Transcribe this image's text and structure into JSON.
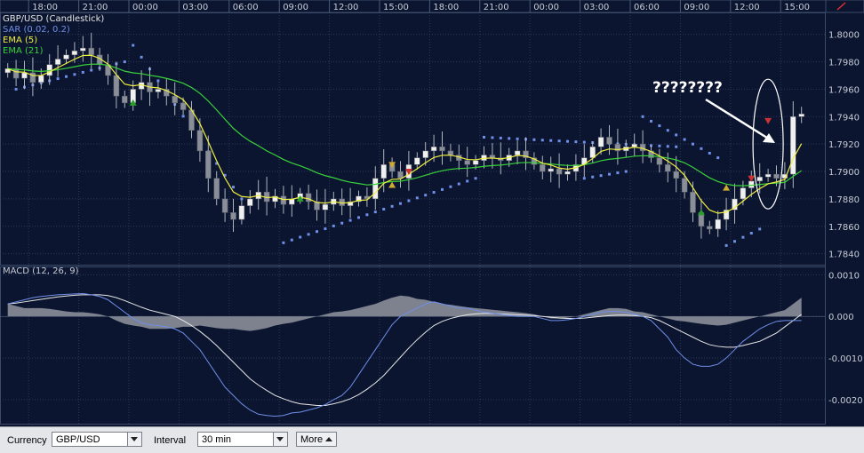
{
  "chart_data": [
    {
      "type": "candlestick",
      "title": "GBP/USD (Candlestick)",
      "legend": [
        "SAR (0.02, 0.2)",
        "EMA (5)",
        "EMA (21)"
      ],
      "legend_colors": [
        "#6f8fe8",
        "#f0f040",
        "#3ad23a"
      ],
      "x_ticks": [
        "18:00",
        "21:00",
        "00:00",
        "03:00",
        "06:00",
        "09:00",
        "12:00",
        "15:00",
        "18:00",
        "21:00",
        "00:00",
        "03:00",
        "06:00",
        "09:00",
        "12:00",
        "15:00",
        "18:00"
      ],
      "y_ticks": [
        "1.8000",
        "1.7980",
        "1.7960",
        "1.7940",
        "1.7920",
        "1.7900",
        "1.7880",
        "1.7860",
        "1.7840"
      ],
      "ylim": [
        1.7832,
        1.8016
      ],
      "n_bars": 96,
      "closes": [
        1.7975,
        1.7968,
        1.7972,
        1.7965,
        1.797,
        1.7978,
        1.7982,
        1.7985,
        1.7988,
        1.799,
        1.7985,
        1.7978,
        1.797,
        1.7955,
        1.795,
        1.796,
        1.7965,
        1.7958,
        1.796,
        1.7955,
        1.795,
        1.7945,
        1.793,
        1.7915,
        1.7895,
        1.788,
        1.787,
        1.7865,
        1.7875,
        1.788,
        1.7885,
        1.7878,
        1.7882,
        1.7876,
        1.788,
        1.7884,
        1.7878,
        1.7872,
        1.7876,
        1.788,
        1.7875,
        1.7878,
        1.7882,
        1.788,
        1.7895,
        1.7905,
        1.79,
        1.7895,
        1.7905,
        1.791,
        1.7915,
        1.7918,
        1.7915,
        1.7912,
        1.7908,
        1.7905,
        1.7908,
        1.7912,
        1.791,
        1.7908,
        1.7912,
        1.7915,
        1.791,
        1.7905,
        1.79,
        1.7902,
        1.7898,
        1.79,
        1.7905,
        1.791,
        1.7918,
        1.7925,
        1.792,
        1.7915,
        1.7918,
        1.792,
        1.7915,
        1.791,
        1.7905,
        1.79,
        1.7895,
        1.7885,
        1.787,
        1.786,
        1.7858,
        1.7865,
        1.7872,
        1.788,
        1.7888,
        1.7893,
        1.7896,
        1.7898,
        1.7895,
        1.7898,
        1.794,
        1.7942
      ],
      "sar_series": [
        {
          "x_start": 1,
          "x_end": 14,
          "y_start": 1.796,
          "y_end": 1.798
        },
        {
          "x_start": 15,
          "x_end": 28,
          "y_start": 1.7992,
          "y_end": 1.788
        },
        {
          "x_start": 33,
          "x_end": 56,
          "y_start": 1.7848,
          "y_end": 1.7895
        },
        {
          "x_start": 57,
          "x_end": 80,
          "y_start": 1.7925,
          "y_end": 1.7918
        },
        {
          "x_start": 69,
          "x_end": 74,
          "y_start": 1.7895,
          "y_end": 1.79
        },
        {
          "x_start": 76,
          "x_end": 85,
          "y_start": 1.794,
          "y_end": 1.791
        },
        {
          "x_start": 86,
          "x_end": 90,
          "y_start": 1.7846,
          "y_end": 1.7858
        }
      ],
      "signals": [
        {
          "bar": 15,
          "price": 1.795,
          "kind": "buy",
          "color": "#2aa02a"
        },
        {
          "bar": 35,
          "price": 1.788,
          "kind": "buy",
          "color": "#2aa02a"
        },
        {
          "bar": 46,
          "price": 1.7905,
          "kind": "sell",
          "color": "#ccaa33"
        },
        {
          "bar": 46,
          "price": 1.789,
          "kind": "buy",
          "color": "#ccaa33"
        },
        {
          "bar": 48,
          "price": 1.79,
          "kind": "sell",
          "color": "#cc3333"
        },
        {
          "bar": 83,
          "price": 1.787,
          "kind": "buy",
          "color": "#2aa02a"
        },
        {
          "bar": 86,
          "price": 1.7888,
          "kind": "buy",
          "color": "#ccaa33"
        },
        {
          "bar": 89,
          "price": 1.7895,
          "kind": "sell",
          "color": "#cc3333"
        },
        {
          "bar": 91,
          "price": 1.7937,
          "kind": "sell",
          "color": "#cc3333"
        }
      ],
      "annotation_text": "????????"
    },
    {
      "type": "macd",
      "title": "MACD (12, 26, 9)",
      "y_ticks": [
        "0.0010",
        "0.000",
        "-0.0010",
        "-0.0020"
      ],
      "ylim": [
        -0.0026,
        0.0012
      ],
      "histogram": [
        0.0003,
        0.00025,
        0.0002,
        0.0002,
        0.0002,
        0.00018,
        0.00015,
        0.00012,
        0.0001,
        0.0001,
        8e-05,
        5e-05,
        0.0,
        -0.0001,
        -0.00018,
        -0.00022,
        -0.00025,
        -0.0003,
        -0.0003,
        -0.0003,
        -0.00028,
        -0.00025,
        -0.00025,
        -0.00022,
        -0.00025,
        -0.00028,
        -0.0003,
        -0.0003,
        -0.00033,
        -0.00035,
        -0.00032,
        -0.00028,
        -0.00022,
        -0.00018,
        -0.00015,
        -0.0001,
        -5e-05,
        0.0,
        5e-05,
        0.0001,
        0.00012,
        0.00015,
        0.0002,
        0.00025,
        0.0003,
        0.00038,
        0.00045,
        0.0005,
        0.00048,
        0.00042,
        0.0004,
        0.00035,
        0.0003,
        0.00028,
        0.00025,
        0.00022,
        0.0002,
        0.00018,
        0.00016,
        0.00014,
        0.00012,
        0.0001,
        8e-05,
        5e-05,
        0.0,
        -5e-05,
        -5e-05,
        -3e-05,
        0.0,
        5e-05,
        0.0001,
        0.00015,
        0.0002,
        0.0002,
        0.00018,
        0.00012,
        0.0001,
        5e-05,
        0.0,
        -5e-05,
        -0.0001,
        -0.00012,
        -0.00015,
        -0.00018,
        -0.0002,
        -0.00022,
        -0.0002,
        -0.00015,
        -0.0001,
        -5e-05,
        0.0,
        5e-05,
        0.0001,
        0.00015,
        0.0003,
        0.00045
      ],
      "macd_line": [
        0.0003,
        0.00035,
        0.0004,
        0.00045,
        0.00048,
        0.0005,
        0.00052,
        0.00053,
        0.00054,
        0.00055,
        0.00052,
        0.00048,
        0.0004,
        0.00025,
        0.0001,
        -5e-05,
        -0.00015,
        -0.0002,
        -0.00022,
        -0.00025,
        -0.0003,
        -0.0004,
        -0.0006,
        -0.0008,
        -0.0011,
        -0.0014,
        -0.0017,
        -0.0019,
        -0.0021,
        -0.00225,
        -0.00235,
        -0.00238,
        -0.0024,
        -0.00238,
        -0.00232,
        -0.0023,
        -0.00225,
        -0.0022,
        -0.00212,
        -0.002,
        -0.0019,
        -0.0017,
        -0.0014,
        -0.0011,
        -0.0008,
        -0.0005,
        -0.0002,
        0.0,
        0.0001,
        0.0002,
        0.0003,
        0.00035,
        0.0003,
        0.00025,
        0.0002,
        0.0002,
        0.00015,
        0.0001,
        8e-05,
        5e-05,
        2e-05,
        0.0,
        0.0,
        0.0,
        -5e-05,
        -0.0001,
        -0.0001,
        -8e-05,
        -5e-05,
        0.0,
        5e-05,
        0.0001,
        0.00012,
        0.00012,
        0.0001,
        5e-05,
        0.0,
        -0.0001,
        -0.0003,
        -0.0005,
        -0.0008,
        -0.001,
        -0.00115,
        -0.0012,
        -0.0012,
        -0.00115,
        -0.001,
        -0.0008,
        -0.0006,
        -0.00045,
        -0.0003,
        -0.0002,
        -0.00012,
        -0.0001,
        -0.0001,
        -0.0001
      ],
      "signal_line": [
        0.0003,
        0.00032,
        0.00035,
        0.00038,
        0.00041,
        0.00044,
        0.00047,
        0.00049,
        0.00051,
        0.00052,
        0.00052,
        0.00052,
        0.0005,
        0.00045,
        0.00038,
        0.0003,
        0.00022,
        0.00015,
        0.0001,
        5e-05,
        0.0,
        -0.0001,
        -0.00022,
        -0.00036,
        -0.00052,
        -0.0007,
        -0.0009,
        -0.0011,
        -0.0013,
        -0.0015,
        -0.00165,
        -0.00178,
        -0.0019,
        -0.00198,
        -0.00205,
        -0.0021,
        -0.00212,
        -0.00214,
        -0.00214,
        -0.0021,
        -0.00205,
        -0.00198,
        -0.00188,
        -0.00175,
        -0.0016,
        -0.00142,
        -0.0012,
        -0.00098,
        -0.00076,
        -0.00056,
        -0.00038,
        -0.00022,
        -0.00012,
        -5e-05,
        0.0,
        4e-05,
        6e-05,
        7e-05,
        7e-05,
        6e-05,
        5e-05,
        4e-05,
        3e-05,
        2e-05,
        0.0,
        -2e-05,
        -4e-05,
        -5e-05,
        -5e-05,
        -4e-05,
        -2e-05,
        0.0,
        2e-05,
        3e-05,
        3e-05,
        2e-05,
        0.0,
        -3e-05,
        -0.0001,
        -0.0002,
        -0.0003,
        -0.0004,
        -0.0005,
        -0.0006,
        -0.00068,
        -0.00072,
        -0.00074,
        -0.00074,
        -0.0007,
        -0.00065,
        -0.0006,
        -0.0005,
        -0.0004,
        -0.00025,
        -0.0001,
        5e-05
      ]
    }
  ],
  "toolbar": {
    "currency_label": "Currency",
    "currency_value": "GBP/USD",
    "interval_label": "Interval",
    "interval_value": "30 min",
    "more_label": "More"
  },
  "colors": {
    "background": "#0b1530",
    "grid": "#2a3a58",
    "candle_up": "#f0f0f0",
    "candle_down": "#8a8e99",
    "sar": "#6f8fe8",
    "ema5": "#f0f040",
    "ema21": "#3ad23a",
    "macd_hist": "#8a8e99",
    "macd_line": "#6f8fe8",
    "macd_signal": "#e8e8e8"
  }
}
